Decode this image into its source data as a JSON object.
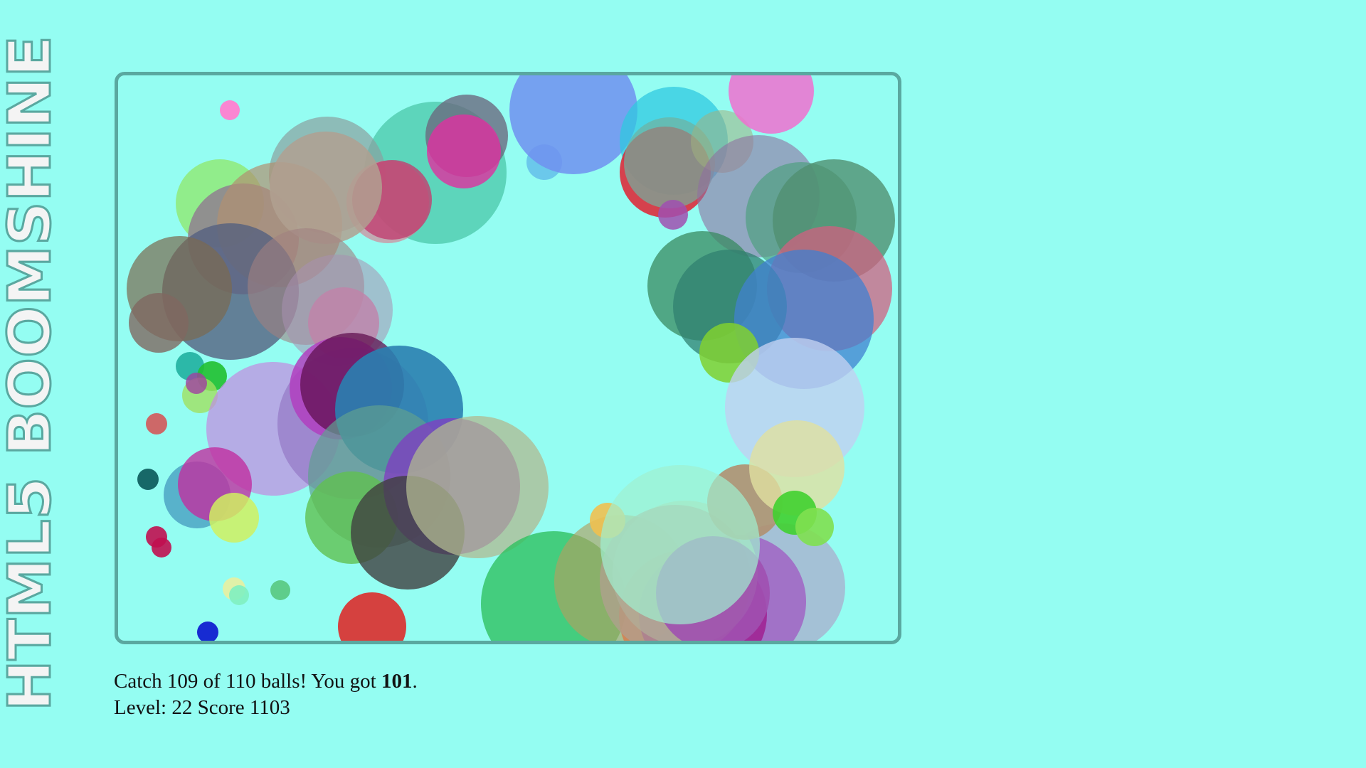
{
  "app": {
    "title": "HTML5 BOOMSHINE",
    "title_color": "#f4f4f4",
    "title_outline": "#5aa8a0",
    "background": "#94fdf2",
    "board_border": "#5aa8a0"
  },
  "status": {
    "goal_prefix": "Catch 109 of 110 balls! You got ",
    "caught": "101",
    "goal_suffix": ".",
    "level_line": "Level: 22 Score 1103"
  },
  "balls": [
    {
      "c": "#4bc7a8",
      "o": 0.75
    },
    {
      "c": "#ff7fd0",
      "o": 0.95
    },
    {
      "c": "#8aa0a0",
      "o": 0.7
    },
    {
      "c": "#d98090",
      "o": 0.65
    },
    {
      "c": "#6a6a80",
      "o": 0.8
    },
    {
      "c": "#e030a0",
      "o": 0.8
    },
    {
      "c": "#5ab0e8",
      "o": 0.7
    },
    {
      "c": "#7090f0",
      "o": 0.85
    },
    {
      "c": "#30c8e0",
      "o": 0.75
    },
    {
      "c": "#e02030",
      "o": 0.85
    },
    {
      "c": "#70b0a0",
      "o": 0.7
    },
    {
      "c": "#a0b080",
      "o": 0.55
    },
    {
      "c": "#f070d0",
      "o": 0.85
    },
    {
      "c": "#9070a0",
      "o": 0.6
    },
    {
      "c": "#50a080",
      "o": 0.7
    },
    {
      "c": "#509070",
      "o": 0.8
    },
    {
      "c": "#d06080",
      "o": 0.75
    },
    {
      "c": "#a050b0",
      "o": 0.85
    },
    {
      "c": "#3a8a60",
      "o": 0.75
    },
    {
      "c": "#308070",
      "o": 0.75
    },
    {
      "c": "#4080d0",
      "o": 0.75
    },
    {
      "c": "#80d030",
      "o": 0.85
    },
    {
      "c": "#90e870",
      "o": 0.8
    },
    {
      "c": "#907090",
      "o": 0.75
    },
    {
      "c": "#b09070",
      "o": 0.7
    },
    {
      "c": "#c04070",
      "o": 0.8
    },
    {
      "c": "#b0a090",
      "o": 0.85
    },
    {
      "c": "#556080",
      "o": 0.8
    },
    {
      "c": "#7a6a50",
      "o": 0.7
    },
    {
      "c": "#806860",
      "o": 0.8
    },
    {
      "c": "#a08080",
      "o": 0.6
    },
    {
      "c": "#e070a0",
      "o": 0.8
    },
    {
      "c": "#a890b0",
      "o": 0.55
    },
    {
      "c": "#20b0a0",
      "o": 0.9
    },
    {
      "c": "#20c030",
      "o": 0.9
    },
    {
      "c": "#a0e060",
      "o": 0.8
    },
    {
      "c": "#a040a0",
      "o": 0.8
    },
    {
      "c": "#c090e0",
      "o": 0.75
    },
    {
      "c": "#9070c0",
      "o": 0.6
    },
    {
      "c": "#b040c0",
      "o": 0.85
    },
    {
      "c": "#601050",
      "o": 0.75
    },
    {
      "c": "#2a80b0",
      "o": 0.9
    },
    {
      "c": "#60a090",
      "o": 0.7
    },
    {
      "c": "#60c050",
      "o": 0.8
    },
    {
      "c": "#8040c0",
      "o": 0.8
    },
    {
      "c": "#404040",
      "o": 0.8
    },
    {
      "c": "#b0b890",
      "o": 0.75
    },
    {
      "c": "#d06060",
      "o": 0.95
    },
    {
      "c": "#106060",
      "o": 0.95
    },
    {
      "c": "#3080b0",
      "o": 0.6
    },
    {
      "c": "#c030a0",
      "o": 0.8
    },
    {
      "c": "#d0f060",
      "o": 0.85
    },
    {
      "c": "#c01050",
      "o": 0.9
    },
    {
      "c": "#c01050",
      "o": 0.9
    },
    {
      "c": "#e8f0a0",
      "o": 0.9
    },
    {
      "c": "#80f0c0",
      "o": 0.9
    },
    {
      "c": "#50c070",
      "o": 0.8
    },
    {
      "c": "#e02020",
      "o": 0.85
    },
    {
      "c": "#1020d0",
      "o": 0.95
    },
    {
      "c": "#30c060",
      "o": 0.8
    },
    {
      "c": "#b0a060",
      "o": 0.65
    },
    {
      "c": "#e07040",
      "o": 0.7
    },
    {
      "c": "#b090c0",
      "o": 0.55
    },
    {
      "c": "#a050c0",
      "o": 0.7
    },
    {
      "c": "#a02090",
      "o": 0.85
    },
    {
      "c": "#b0d8b0",
      "o": 0.7
    },
    {
      "c": "#b0a090",
      "o": 0.75
    },
    {
      "c": "#f0c050",
      "o": 0.9
    },
    {
      "c": "#b09070",
      "o": 0.9
    },
    {
      "c": "#c0d0f0",
      "o": 0.8
    },
    {
      "c": "#e0e0a0",
      "o": 0.8
    },
    {
      "c": "#40d030",
      "o": 0.9
    },
    {
      "c": "#80e050",
      "o": 0.9
    },
    {
      "c": "#a050b0",
      "o": 0.9
    },
    {
      "c": "#a0f0d0",
      "o": 0.7
    }
  ]
}
